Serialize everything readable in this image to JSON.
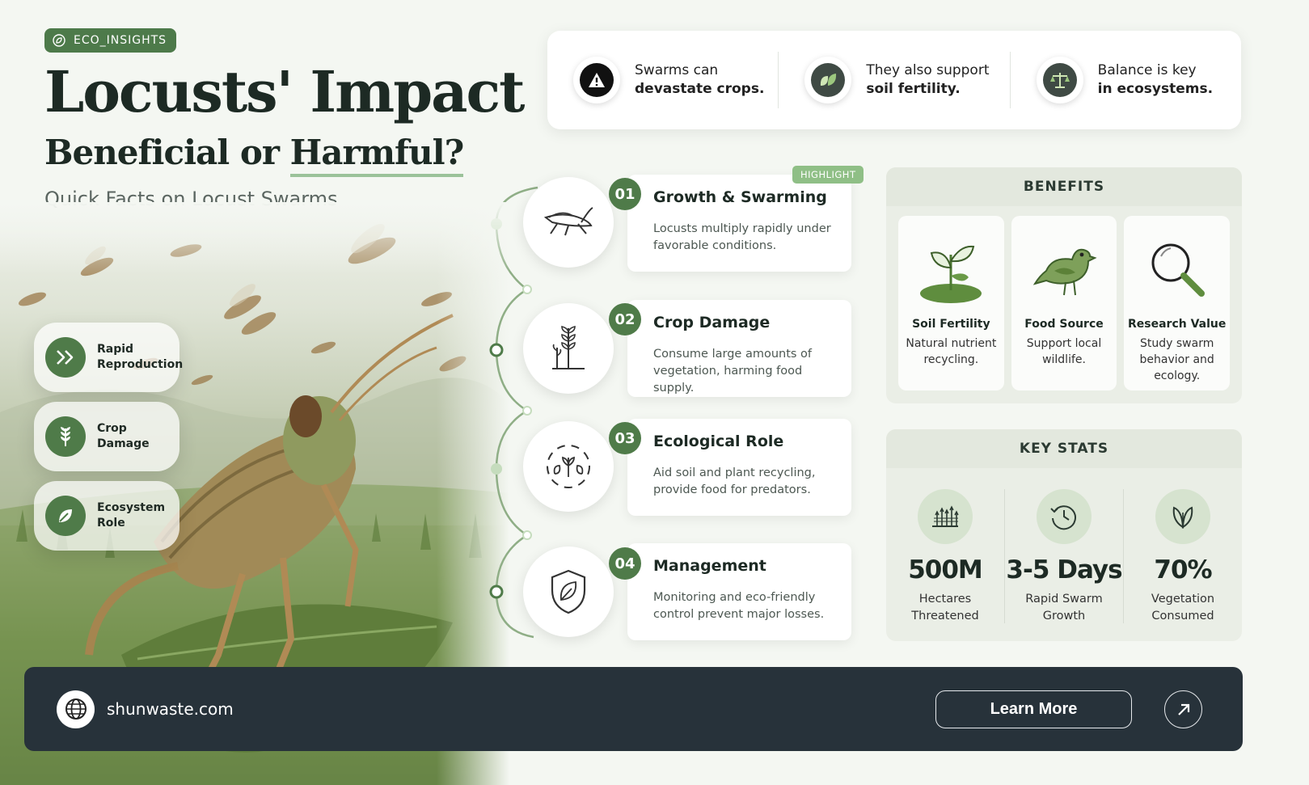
{
  "brand_badge": "ECO_INSIGHTS",
  "title": "Locusts' Impact",
  "subtitle_part1": "Beneficial or ",
  "subtitle_part2": "Harmful?",
  "tagline": "Quick Facts on Locust Swarms",
  "side_pills": [
    {
      "line1": "Rapid",
      "line2": "Reproduction",
      "icon": "fast-forward-icon"
    },
    {
      "line1": "Crop",
      "line2": "Damage",
      "icon": "wheat-icon"
    },
    {
      "line1": "Ecosystem",
      "line2": "Role",
      "icon": "leaf-icon"
    }
  ],
  "summary": [
    {
      "line1": "Swarms can",
      "line2": "devastate crops.",
      "icon": "warning-icon"
    },
    {
      "line1": "They also support",
      "line2": "soil fertility.",
      "icon": "leaf-icon"
    },
    {
      "line1": "Balance is key",
      "line2": "in ecosystems.",
      "icon": "scales-icon"
    }
  ],
  "highlight_label": "HIGHLIGHT",
  "steps": [
    {
      "num": "01",
      "title": "Growth & Swarming",
      "desc": "Locusts multiply rapidly under favorable conditions.",
      "icon": "locust-icon"
    },
    {
      "num": "02",
      "title": "Crop Damage",
      "desc": "Consume large amounts of vegetation, harming food supply.",
      "icon": "crop-icon"
    },
    {
      "num": "03",
      "title": "Ecological Role",
      "desc": "Aid soil and plant recycling, provide food for predators.",
      "icon": "cycle-icon"
    },
    {
      "num": "04",
      "title": "Management",
      "desc": "Monitoring and eco-friendly control prevent major losses.",
      "icon": "shield-leaf-icon"
    }
  ],
  "benefits": {
    "heading": "BENEFITS",
    "items": [
      {
        "title": "Soil Fertility",
        "desc": "Natural nutrient recycling.",
        "icon": "sprout-icon"
      },
      {
        "title": "Food Source",
        "desc": "Support local wildlife.",
        "icon": "bird-icon"
      },
      {
        "title": "Research Value",
        "desc": "Study swarm behavior and ecology.",
        "icon": "magnifier-icon"
      }
    ]
  },
  "key_stats": {
    "heading": "KEY STATS",
    "items": [
      {
        "value": "500M",
        "line1": "Hectares",
        "line2": "Threatened",
        "icon": "field-icon"
      },
      {
        "value": "3-5 Days",
        "line1": "Rapid Swarm",
        "line2": "Growth",
        "icon": "clock-icon"
      },
      {
        "value": "70%",
        "line1": "Vegetation",
        "line2": "Consumed",
        "icon": "leaf-icon"
      }
    ]
  },
  "footer": {
    "website": "shunwaste.com",
    "cta": "Learn More",
    "icons": [
      "globe-icon",
      "arrow-up-right-icon"
    ]
  },
  "colors": {
    "accent": "#4f7b49",
    "footer_bg": "#27323a",
    "highlight": "#8fbf86"
  }
}
